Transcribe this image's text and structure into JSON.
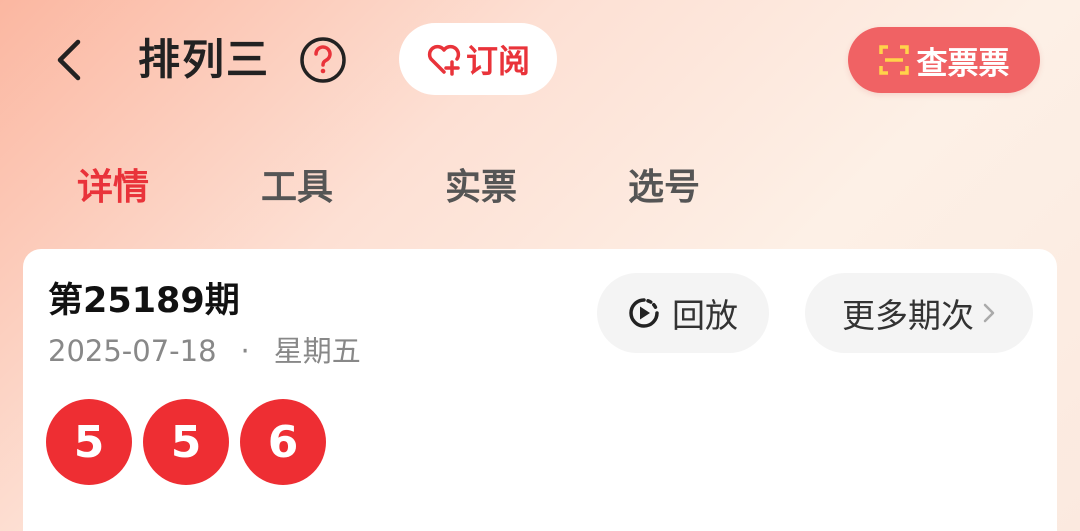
{
  "header": {
    "title": "排列三",
    "subscribe_label": "订阅",
    "check_ticket_label": "查票票"
  },
  "tabs": [
    {
      "label": "详情",
      "active": true
    },
    {
      "label": "工具",
      "active": false
    },
    {
      "label": "实票",
      "active": false
    },
    {
      "label": "选号",
      "active": false
    }
  ],
  "draw": {
    "issue": "第25189期",
    "date": "2025-07-18",
    "separator": "·",
    "weekday": "星期五",
    "replay_label": "回放",
    "more_label": "更多期次",
    "numbers": [
      "5",
      "5",
      "6"
    ]
  },
  "colors": {
    "accent": "#e9333a",
    "ball": "#ee2e33",
    "check_ticket_bg": "#f06264"
  },
  "icons": {
    "back": "chevron-left-icon",
    "help": "question-circle-icon",
    "subscribe": "heart-plus-icon",
    "scan": "scan-icon",
    "replay": "play-circle-icon",
    "more": "chevron-right-icon"
  }
}
